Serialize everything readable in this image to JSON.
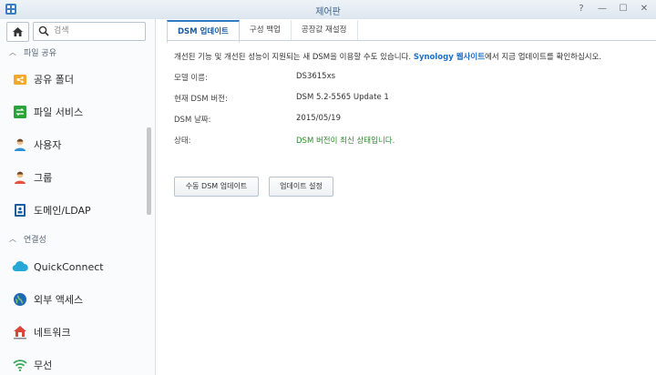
{
  "window": {
    "title": "제어판",
    "buttons": [
      "?",
      "—",
      "☐",
      "✕"
    ]
  },
  "sidebar": {
    "search_placeholder": "검색",
    "sections": [
      {
        "label": "파일 공유"
      },
      {
        "label": "연결성"
      }
    ],
    "items": [
      {
        "label": "공유 폴더",
        "icon": "shared-folder-icon"
      },
      {
        "label": "파일 서비스",
        "icon": "file-services-icon"
      },
      {
        "label": "사용자",
        "icon": "user-icon"
      },
      {
        "label": "그룹",
        "icon": "group-icon"
      },
      {
        "label": "도메인/LDAP",
        "icon": "domain-ldap-icon"
      },
      {
        "label": "QuickConnect",
        "icon": "quickconnect-icon"
      },
      {
        "label": "외부 액세스",
        "icon": "external-access-icon"
      },
      {
        "label": "네트워크",
        "icon": "network-icon"
      },
      {
        "label": "무선",
        "icon": "wireless-icon"
      }
    ]
  },
  "tabs": [
    {
      "label": "DSM 업데이트",
      "active": true
    },
    {
      "label": "구성 백업",
      "active": false
    },
    {
      "label": "공장값 재설정",
      "active": false
    }
  ],
  "main": {
    "description_pre": "개선된 기능 및 개선된 성능이 지원되는 새 DSM을 이용할 수도 있습니다. ",
    "description_link": "Synology 웹사이트",
    "description_post": "에서 지금 업데이트를 확인하십시오.",
    "fields": [
      {
        "label": "모델 이름:",
        "value": "DS3615xs"
      },
      {
        "label": "현재 DSM 버전:",
        "value": "DSM 5.2-5565 Update 1"
      },
      {
        "label": "DSM 날짜:",
        "value": "2015/05/19"
      },
      {
        "label": "상태:",
        "value": "DSM 버전이 최신 상태입니다."
      }
    ],
    "manual_update_button": "수동 DSM 업데이트",
    "update_settings_button": "업데이트 설정"
  },
  "colors": {
    "accent": "#2e7bc4",
    "link": "#1f6fc5",
    "status_ok": "#2e8b2e"
  }
}
